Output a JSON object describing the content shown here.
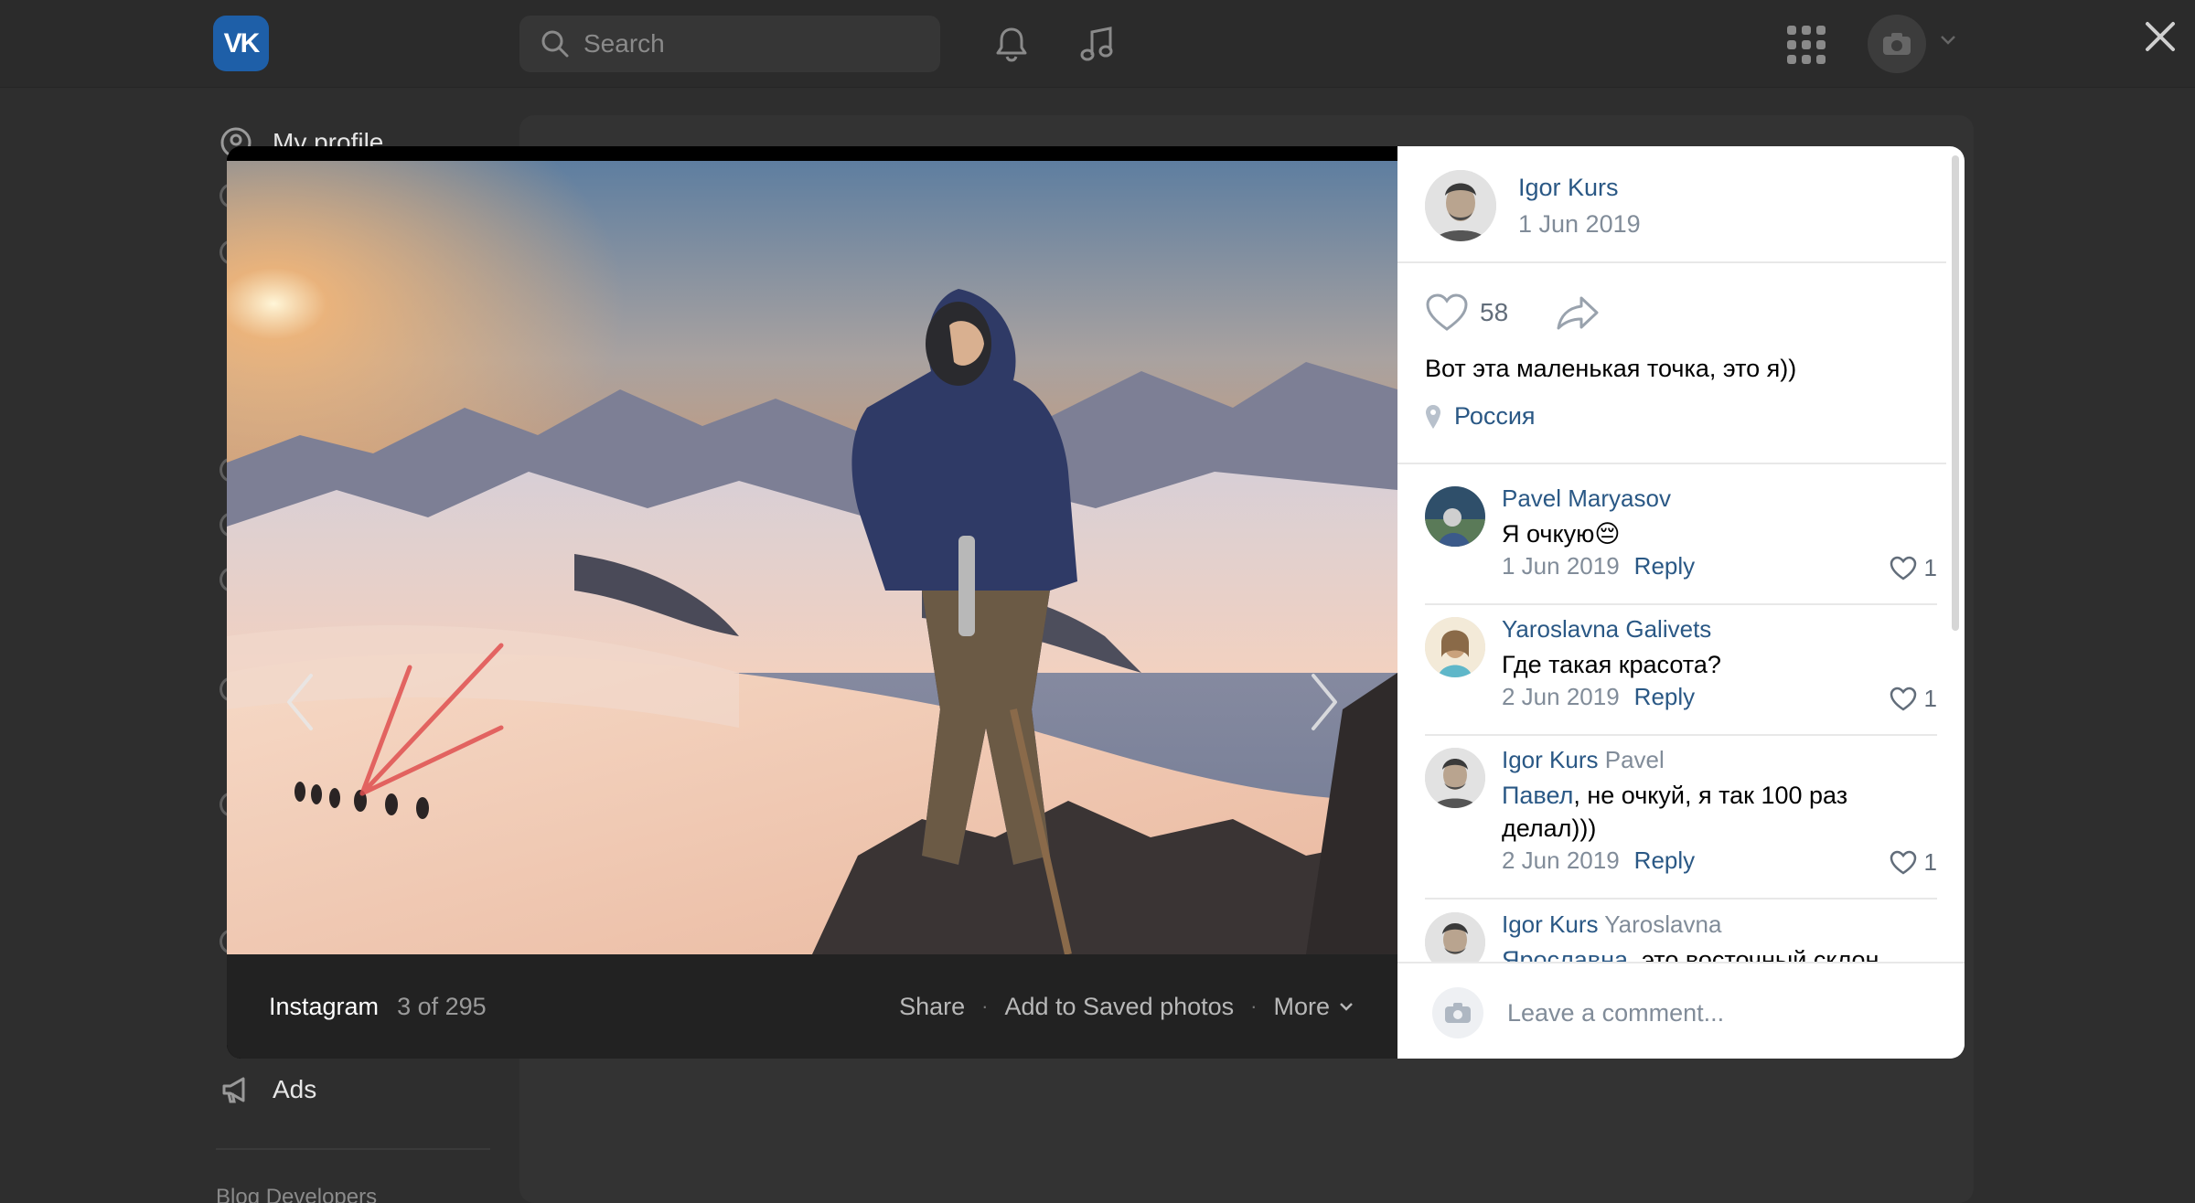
{
  "header": {
    "logo_text": "VK",
    "search_placeholder": "Search",
    "icons": [
      "bell-icon",
      "music-icon",
      "apps-grid-icon",
      "camera-icon",
      "chevron-down-icon",
      "close-icon"
    ]
  },
  "left_nav": {
    "my_profile": "My profile",
    "ads": "Ads",
    "footer": "Blog  Developers"
  },
  "photo_viewer": {
    "album": "Instagram",
    "counter": "3 of 295",
    "actions": {
      "share": "Share",
      "save": "Add to Saved photos",
      "more": "More"
    }
  },
  "post": {
    "author": "Igor Kurs",
    "date": "1 Jun 2019",
    "likes": "58",
    "text": "Вот эта маленькая точка, это я))",
    "location": "Россия"
  },
  "comments": [
    {
      "author": "Pavel Maryasov",
      "reply_to": "",
      "mention": "",
      "text": "Я очкую😔",
      "date": "1 Jun 2019",
      "reply": "Reply",
      "likes": "1"
    },
    {
      "author": "Yaroslavna Galivets",
      "reply_to": "",
      "mention": "",
      "text": "Где такая красота?",
      "date": "2 Jun 2019",
      "reply": "Reply",
      "likes": "1"
    },
    {
      "author": "Igor Kurs",
      "reply_to": "Pavel",
      "mention": "Павел",
      "text": ", не очкуй, я так 100 раз делал)))",
      "date": "2 Jun 2019",
      "reply": "Reply",
      "likes": "1"
    },
    {
      "author": "Igor Kurs",
      "reply_to": "Yaroslavna",
      "mention": "Ярославна",
      "text": ", это восточный склон",
      "date": "",
      "reply": "",
      "likes": ""
    }
  ],
  "comment_box": {
    "placeholder": "Leave a comment..."
  },
  "colors": {
    "link": "#2a5885",
    "muted": "#818c99",
    "vk_blue": "#1e5fa8"
  }
}
